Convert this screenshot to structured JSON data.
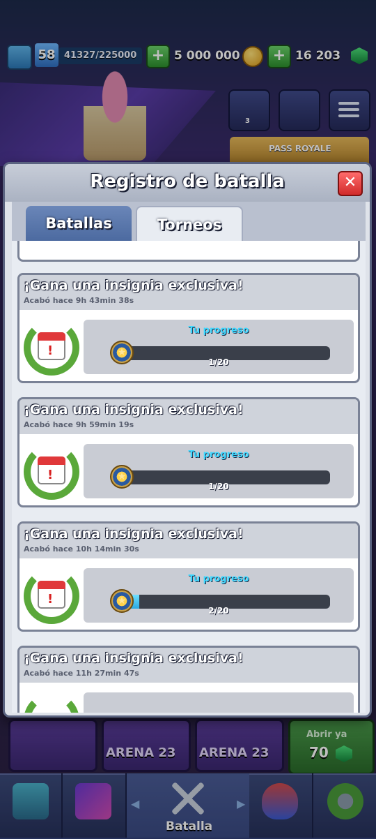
{
  "topbar": {
    "level": "58",
    "xp": "41327/225000",
    "gold": "5 000 000",
    "gems": "16 203"
  },
  "background": {
    "pass_label": "PASS ROYALE",
    "friends_count": "3",
    "arena_cards": [
      "ARENA 23",
      "ARENA 23"
    ],
    "open_now_label": "Abrir ya",
    "open_now_price": "70"
  },
  "bottom_nav": {
    "active_label": "Batalla"
  },
  "modal": {
    "title": "Registro de batalla",
    "tabs": [
      {
        "label": "Batallas"
      },
      {
        "label": "Torneos"
      }
    ],
    "entries": [
      {
        "title": "¡Gana una insignia exclusiva!",
        "time": "Acabó hace 9h 43min 38s",
        "progress_label": "Tu progreso",
        "progress_text": "1/20",
        "progress_value": 0.05
      },
      {
        "title": "¡Gana una insignia exclusiva!",
        "time": "Acabó hace 9h 59min 19s",
        "progress_label": "Tu progreso",
        "progress_text": "1/20",
        "progress_value": 0.05
      },
      {
        "title": "¡Gana una insignia exclusiva!",
        "time": "Acabó hace 10h 14min 30s",
        "progress_label": "Tu progreso",
        "progress_text": "2/20",
        "progress_value": 0.1
      },
      {
        "title": "¡Gana una insignia exclusiva!",
        "time": "Acabó hace 11h 27min 47s"
      }
    ]
  },
  "colors": {
    "progress_fill": "#2ca8e0",
    "progress_label": "#3fd8ff",
    "close_button": "#d12b2b"
  }
}
